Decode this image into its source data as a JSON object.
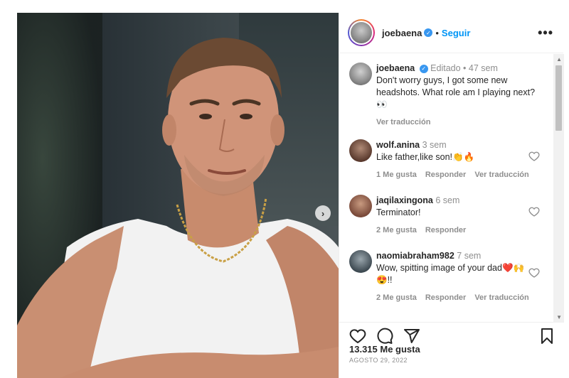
{
  "header": {
    "username": "joebaena",
    "separator": "•",
    "follow_label": "Seguir",
    "more_label": "•••"
  },
  "caption": {
    "username": "joebaena",
    "edited": "Editado",
    "separator": "•",
    "age": "47 sem",
    "text": "Don't worry guys, I got some new headshots. What role am I playing next? 👀",
    "translate_label": "Ver traducción"
  },
  "comments": [
    {
      "username": "wolf.anina",
      "age": "3 sem",
      "text": "Like father,like son!👏🔥",
      "likes": "1 Me gusta",
      "reply_label": "Responder",
      "translate_label": "Ver traducción",
      "avatar_color": "#5a3a2e"
    },
    {
      "username": "jaqilaxingona",
      "age": "6 sem",
      "text": "Terminator!",
      "likes": "2 Me gusta",
      "reply_label": "Responder",
      "translate_label": "",
      "avatar_color": "#7a4a3a"
    },
    {
      "username": "naomiabraham982",
      "age": "7 sem",
      "text": "Wow, spitting image of your dad❤️🙌😍!!",
      "likes": "2 Me gusta",
      "reply_label": "Responder",
      "translate_label": "Ver traducción",
      "avatar_color": "#3e4a52"
    }
  ],
  "actions": {
    "likes_count": "13.315 Me gusta",
    "date": "AGOSTO 29, 2022"
  },
  "icons": {
    "verified": "verified-badge-icon",
    "heart": "heart-icon",
    "comment": "comment-icon",
    "share": "share-icon",
    "save": "bookmark-icon",
    "next": "chevron-right-icon"
  },
  "colors": {
    "accent": "#0095f6",
    "verified": "#3897f0",
    "muted": "#8e8e8e",
    "text": "#262626"
  }
}
